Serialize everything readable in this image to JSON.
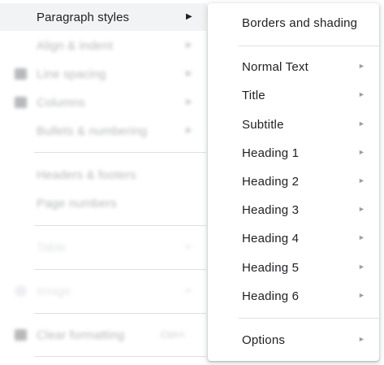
{
  "parent_menu": {
    "active_item": {
      "label": "Paragraph styles",
      "arrow": "▶"
    },
    "faded_items": [
      {
        "label": "Align & indent",
        "arrow": "▶"
      },
      {
        "label": "Line spacing",
        "arrow": "▶"
      },
      {
        "label": "Columns",
        "arrow": "▶"
      },
      {
        "label": "Bullets & numbering",
        "arrow": "▶"
      },
      {
        "label": "Headers & footers"
      },
      {
        "label": "Page numbers"
      },
      {
        "label": "Table",
        "arrow": "▶"
      },
      {
        "label": "Image",
        "arrow": "▶"
      },
      {
        "label": "Clear formatting",
        "shortcut": "Ctrl+\\"
      }
    ]
  },
  "submenu": {
    "borders_label": "Borders and shading",
    "items": [
      {
        "label": "Normal Text",
        "arrow": "►"
      },
      {
        "label": "Title",
        "arrow": "►"
      },
      {
        "label": "Subtitle",
        "arrow": "►"
      },
      {
        "label": "Heading 1",
        "arrow": "►"
      },
      {
        "label": "Heading 2",
        "arrow": "►"
      },
      {
        "label": "Heading 3",
        "arrow": "►"
      },
      {
        "label": "Heading 4",
        "arrow": "►"
      },
      {
        "label": "Heading 5",
        "arrow": "►"
      },
      {
        "label": "Heading 6",
        "arrow": "►"
      }
    ],
    "options": {
      "label": "Options",
      "arrow": "►"
    }
  }
}
